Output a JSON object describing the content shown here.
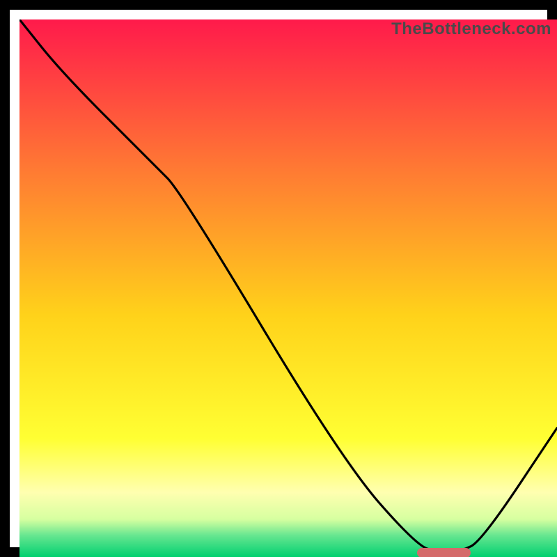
{
  "watermark": "TheBottleneck.com",
  "chart_data": {
    "type": "line",
    "title": "",
    "xlabel": "",
    "ylabel": "",
    "x_range": [
      0,
      100
    ],
    "y_range": [
      0,
      100
    ],
    "curve": {
      "x": [
        0,
        8,
        25,
        30,
        60,
        74,
        78,
        82,
        86,
        100
      ],
      "y": [
        100,
        90,
        73,
        68,
        18,
        2,
        1,
        1,
        3,
        24
      ]
    },
    "marker": {
      "x_start": 74,
      "x_end": 84,
      "y": 0.8
    },
    "colors": {
      "top": "#ff1a4b",
      "mid1": "#ff7a33",
      "mid2": "#ffd21a",
      "mid3": "#ffff33",
      "band": "#ffffb0",
      "low1": "#d6ffa0",
      "low2": "#66e690",
      "bottom": "#00d070",
      "curve": "#000000",
      "marker": "#d46a6a",
      "frame": "#000000"
    }
  }
}
